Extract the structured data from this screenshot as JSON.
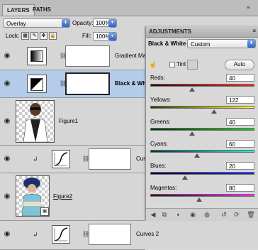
{
  "tabs": {
    "layers": "LAYERS",
    "paths": "PATHS"
  },
  "blend_mode": "Overlay",
  "opacity": {
    "label": "Opacity:",
    "value": "100%"
  },
  "lock": {
    "label": "Lock:"
  },
  "fill": {
    "label": "Fill:",
    "value": "100%"
  },
  "layers": [
    {
      "name": "Gradient Map",
      "type": "adjustment-gradient"
    },
    {
      "name": "Black & White",
      "type": "adjustment-bw",
      "selected": true
    },
    {
      "name": "Figure1",
      "type": "image"
    },
    {
      "name": "Curves",
      "type": "adjustment-curves"
    },
    {
      "name": "Figure2",
      "type": "image"
    },
    {
      "name": "Curves 2",
      "type": "adjustment-curves"
    }
  ],
  "adjustments": {
    "title": "ADJUSTMENTS",
    "name": "Black & White",
    "preset": "Custom",
    "tint_label": "Tint",
    "auto_label": "Auto",
    "sliders": [
      {
        "label": "Reds:",
        "value": "40",
        "level": 0.4
      },
      {
        "label": "Yellows:",
        "value": "122",
        "level": 0.61
      },
      {
        "label": "Greens:",
        "value": "40",
        "level": 0.4
      },
      {
        "label": "Cyans:",
        "value": "60",
        "level": 0.45
      },
      {
        "label": "Blues:",
        "value": "20",
        "level": 0.33
      },
      {
        "label": "Magentas:",
        "value": "80",
        "level": 0.47
      }
    ]
  },
  "colors": {
    "selection": "#b4cbe9",
    "accent": "#2e64c4"
  }
}
